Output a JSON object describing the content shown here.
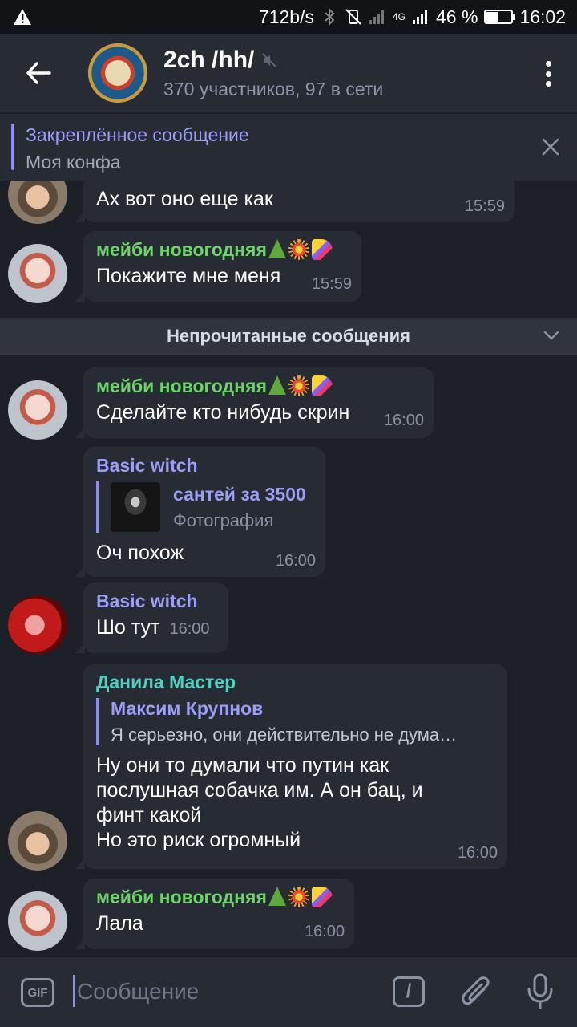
{
  "status_bar": {
    "speed": "712b/s",
    "network": "4G",
    "battery_percent": "46 %",
    "battery_level": 0.46,
    "time": "16:02"
  },
  "header": {
    "title": "2ch /hh/",
    "subtitle": "370 участников, 97 в сети",
    "icons": [
      "back-arrow-icon",
      "muted-icon",
      "more-vert-icon"
    ]
  },
  "pinned": {
    "title": "Закреплённое сообщение",
    "text": "Моя конфа"
  },
  "unread_divider": "Непрочитанные сообщения",
  "messages": [
    {
      "sender": "",
      "text": "Ах вот оно еще как",
      "time": "15:59"
    },
    {
      "sender": "мейби новогодняя",
      "sender_color": "#6ed36a",
      "text": "Покажите мне меня",
      "time": "15:59"
    },
    {
      "sender": "мейби новогодняя",
      "sender_color": "#6ed36a",
      "text": "Сделайте кто нибудь скрин",
      "time": "16:00"
    },
    {
      "sender": "Basic witch",
      "sender_color": "#9b9ef5",
      "reply_name": "сантей за 3500",
      "reply_text": "Фотография",
      "text": "Оч похож",
      "time": "16:00"
    },
    {
      "sender": "Basic witch",
      "sender_color": "#9b9ef5",
      "text": "Шо тут",
      "time": "16:00"
    },
    {
      "sender": "Данила Мастер",
      "sender_color": "#4fd0c0",
      "reply_name": "Максим Крупнов",
      "reply_text": "Я серьезно, они действительно не дума…",
      "lines": [
        "Ну они то думали что путин как",
        "послушная собачка им. А он бац, и",
        "финт какой",
        "Но это риск огромный"
      ],
      "time": "16:00"
    },
    {
      "sender": "мейби новогодняя",
      "sender_color": "#6ed36a",
      "text": "Лала",
      "time": "16:00"
    }
  ],
  "input": {
    "gif_label": "GIF",
    "placeholder": "Сообщение",
    "cmd_label": "/"
  },
  "colors": {
    "background": "#1d2027",
    "header": "#272b34",
    "bubble": "#272b33",
    "accent": "#8c8ff0"
  }
}
